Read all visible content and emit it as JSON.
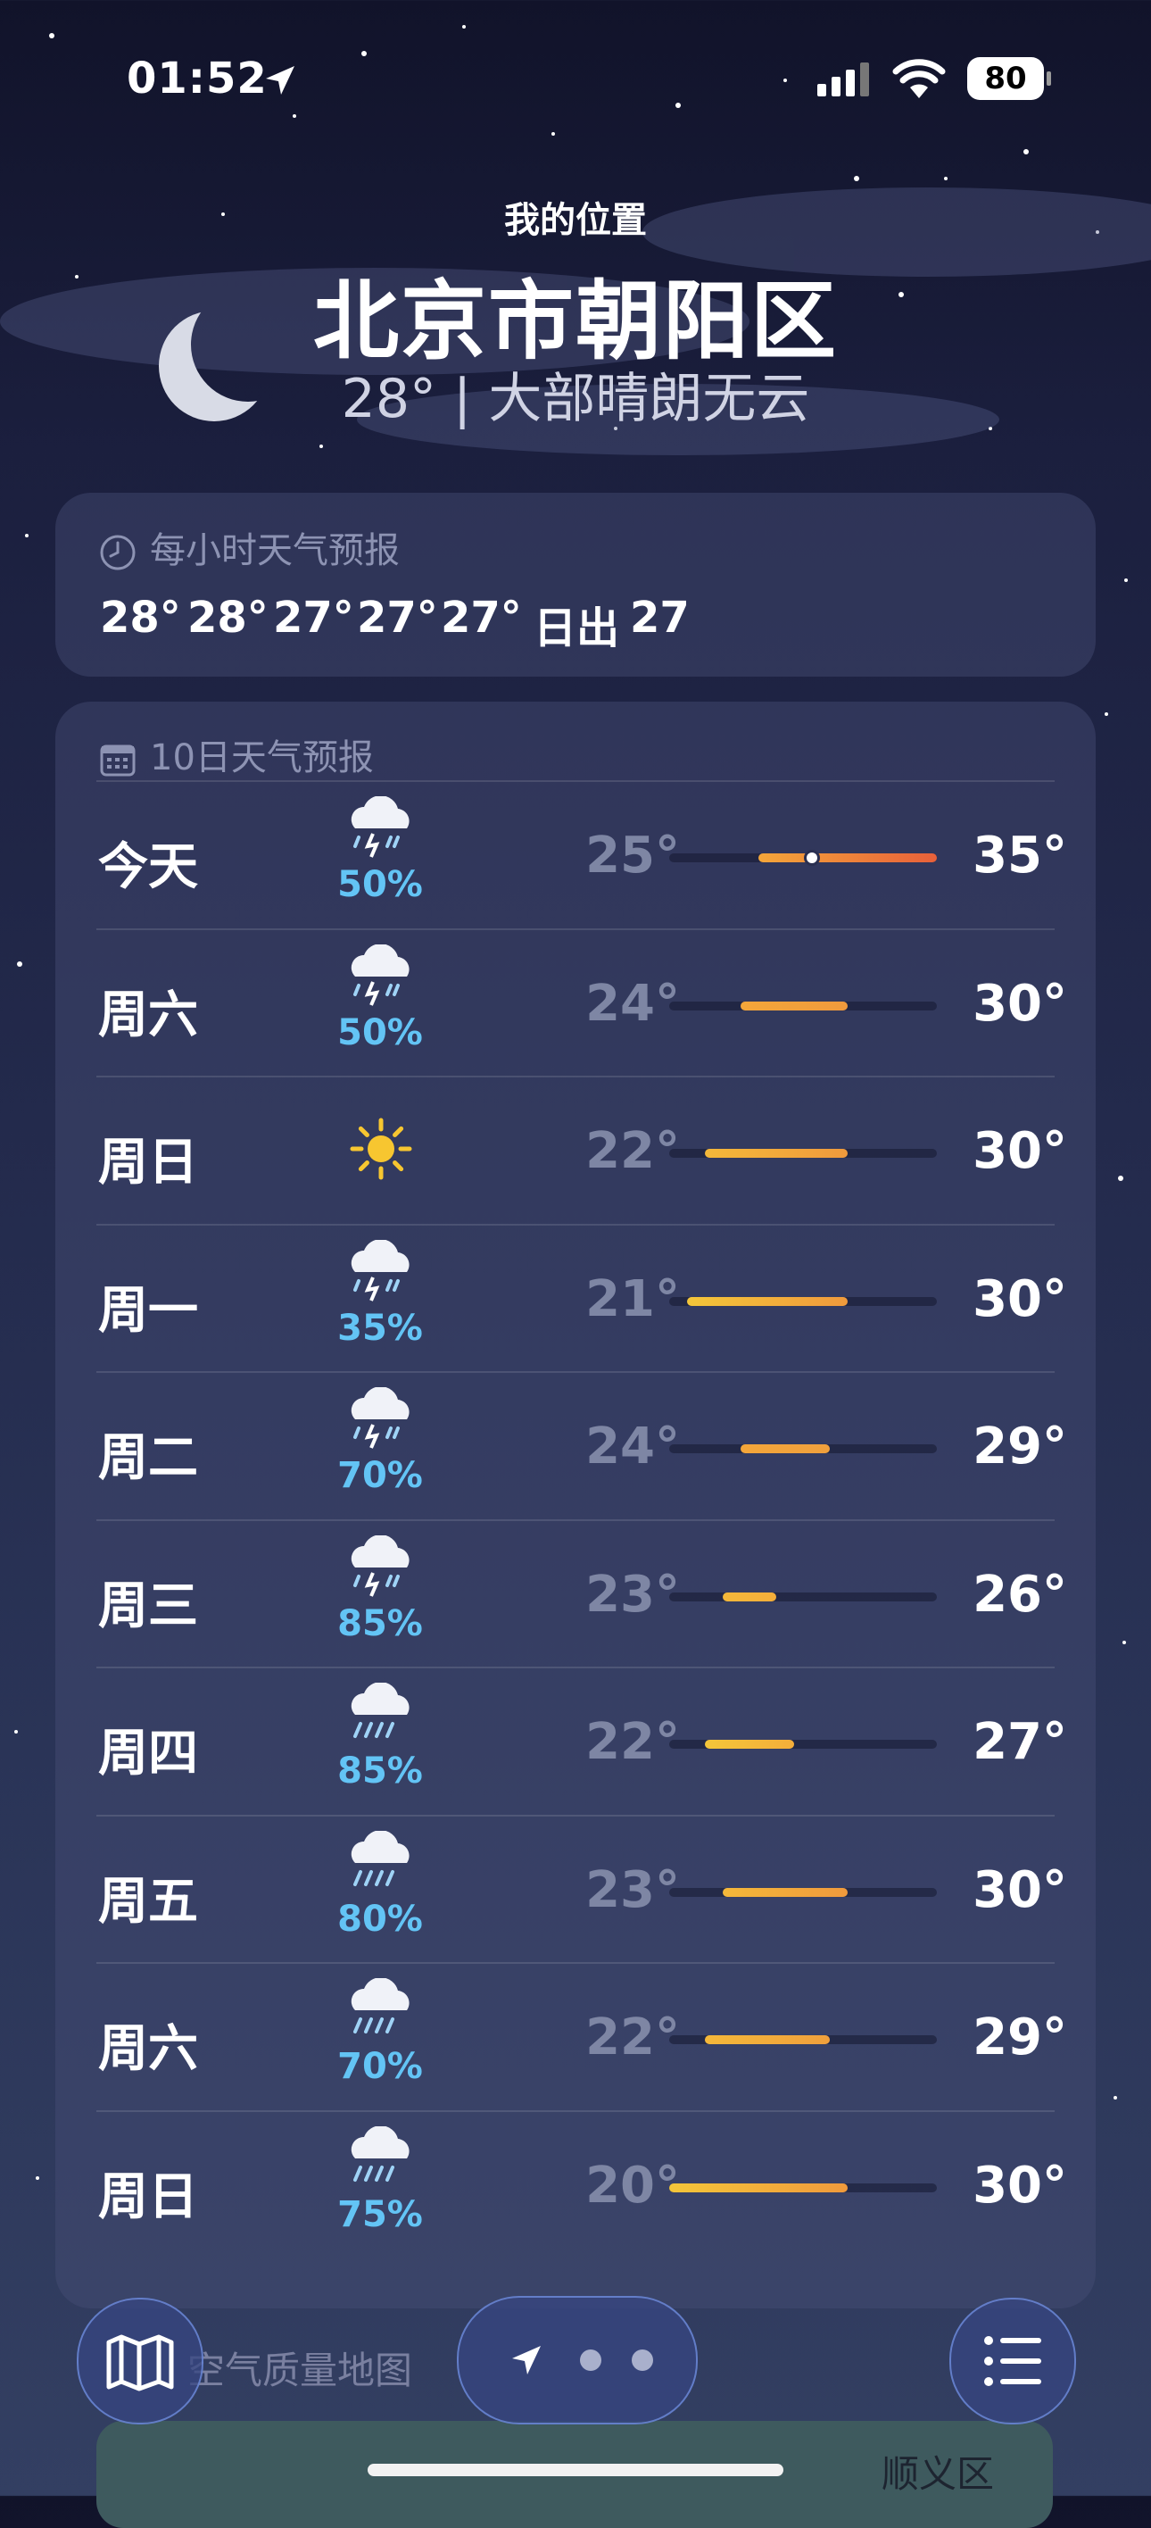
{
  "status_bar": {
    "time": "01:52",
    "battery": "80"
  },
  "header": {
    "location_label": "我的位置",
    "city": "北京市朝阳区",
    "condition": "28° | 大部晴朗无云"
  },
  "hourly": {
    "title": "每小时天气预报",
    "items": [
      "28°",
      "28°",
      "27°",
      "27°",
      "27°",
      "日出",
      "27"
    ]
  },
  "daily": {
    "title": "10日天气预报",
    "range": {
      "min": 20,
      "max": 35
    },
    "rows": [
      {
        "day": "今天",
        "icon": "thunderstorm-icon",
        "precip": "50%",
        "low": "25°",
        "high": "35°",
        "low_val": 25,
        "high_val": 35,
        "current": 28,
        "colors": [
          "#f4a63a",
          "#e8603a"
        ]
      },
      {
        "day": "周六",
        "icon": "thunderstorm-icon",
        "precip": "50%",
        "low": "24°",
        "high": "30°",
        "low_val": 24,
        "high_val": 30,
        "colors": [
          "#f4a63a",
          "#f09a3c"
        ]
      },
      {
        "day": "周日",
        "icon": "sun-icon",
        "precip": "",
        "low": "22°",
        "high": "30°",
        "low_val": 22,
        "high_val": 30,
        "colors": [
          "#f4b83a",
          "#f09a3c"
        ]
      },
      {
        "day": "周一",
        "icon": "thunderstorm-icon",
        "precip": "35%",
        "low": "21°",
        "high": "30°",
        "low_val": 21,
        "high_val": 30,
        "colors": [
          "#f4c63a",
          "#f09a3c"
        ]
      },
      {
        "day": "周二",
        "icon": "thunderstorm-icon",
        "precip": "70%",
        "low": "24°",
        "high": "29°",
        "low_val": 24,
        "high_val": 29,
        "colors": [
          "#f4a63a",
          "#f0a03c"
        ]
      },
      {
        "day": "周三",
        "icon": "thunderstorm-icon",
        "precip": "85%",
        "low": "23°",
        "high": "26°",
        "low_val": 23,
        "high_val": 26,
        "colors": [
          "#f4b83a",
          "#f4ae3a"
        ]
      },
      {
        "day": "周四",
        "icon": "rain-icon",
        "precip": "85%",
        "low": "22°",
        "high": "27°",
        "low_val": 22,
        "high_val": 27,
        "colors": [
          "#f4c63a",
          "#f4ae3a"
        ]
      },
      {
        "day": "周五",
        "icon": "rain-icon",
        "precip": "80%",
        "low": "23°",
        "high": "30°",
        "low_val": 23,
        "high_val": 30,
        "colors": [
          "#f4b83a",
          "#f09a3c"
        ]
      },
      {
        "day": "周六",
        "icon": "rain-icon",
        "precip": "70%",
        "low": "22°",
        "high": "29°",
        "low_val": 22,
        "high_val": 29,
        "colors": [
          "#f4b83a",
          "#f0a03c"
        ]
      },
      {
        "day": "周日",
        "icon": "rain-icon",
        "precip": "75%",
        "low": "20°",
        "high": "30°",
        "low_val": 20,
        "high_val": 30,
        "colors": [
          "#f4c63a",
          "#f09a3c"
        ]
      }
    ]
  },
  "air_quality": {
    "title": "空气质量地图",
    "town": "顺义区"
  },
  "bottom_bar": {
    "map_icon": "map-icon",
    "location_icon": "location-arrow-icon",
    "list_icon": "list-icon",
    "page_dots": 2
  }
}
